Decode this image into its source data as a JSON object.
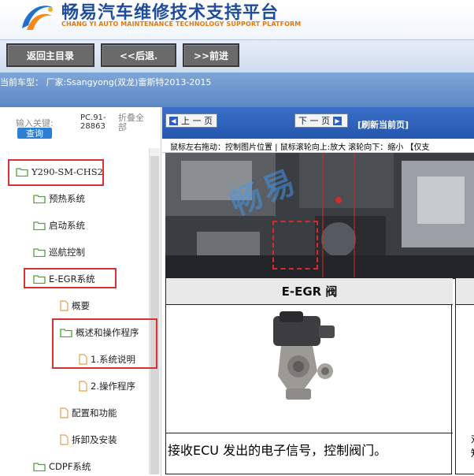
{
  "header": {
    "title": "畅易汽车维修技术支持平台",
    "subtitle": "CHANG YI AUTO MAINTENANCE TECHNOLOGY SUPPORT PLATFORM"
  },
  "toolbar": {
    "back_home": "返回主目录",
    "prev": "<<后退.",
    "next": ">>前进"
  },
  "current_model": "当前车型： 厂家:Ssangyong(双龙)雷斯特2013-2015",
  "search": {
    "keyword_label": "输入关键:",
    "query_button": "查询",
    "pc_code": "PC.91-28863",
    "fold_all": "折叠全部"
  },
  "tree": [
    {
      "label": "Y290-SM-CHS2",
      "type": "folder",
      "highlight": true
    },
    {
      "label": "预热系统",
      "type": "folder"
    },
    {
      "label": "启动系统",
      "type": "folder"
    },
    {
      "label": "巡航控制",
      "type": "folder"
    },
    {
      "label": "E-EGR系统",
      "type": "folder",
      "highlight": true
    },
    {
      "label": "概要",
      "type": "doc"
    },
    {
      "label": "概述和操作程序",
      "type": "folder",
      "highlight": true
    },
    {
      "label": "1.系统说明",
      "type": "doc",
      "highlight": true
    },
    {
      "label": "2.操作程序",
      "type": "doc"
    },
    {
      "label": "配置和功能",
      "type": "doc"
    },
    {
      "label": "拆卸及安装",
      "type": "doc"
    },
    {
      "label": "CDPF系统",
      "type": "folder"
    }
  ],
  "viewer": {
    "prev_page": "上 一 页",
    "next_page": "下 一 页",
    "refresh": "[刷新当前页]",
    "hint": "鼠标左右拖动：控制图片位置 | 鼠标滚轮向上:放大  滚轮向下：缩小 【仅支",
    "watermark": "畅易",
    "valve_title": "E-EGR 阀",
    "valve_description": "接收ECU 发出的电子信号，控制阀门。",
    "side_fragment": "对\n知"
  },
  "colors": {
    "brand_blue": "#1f4d9c",
    "brand_orange": "#e07a10",
    "nav_blue": "#2456ad",
    "highlight_red": "#d93232",
    "folder_green": "#4aa832",
    "doc_orange": "#e8a04a"
  }
}
